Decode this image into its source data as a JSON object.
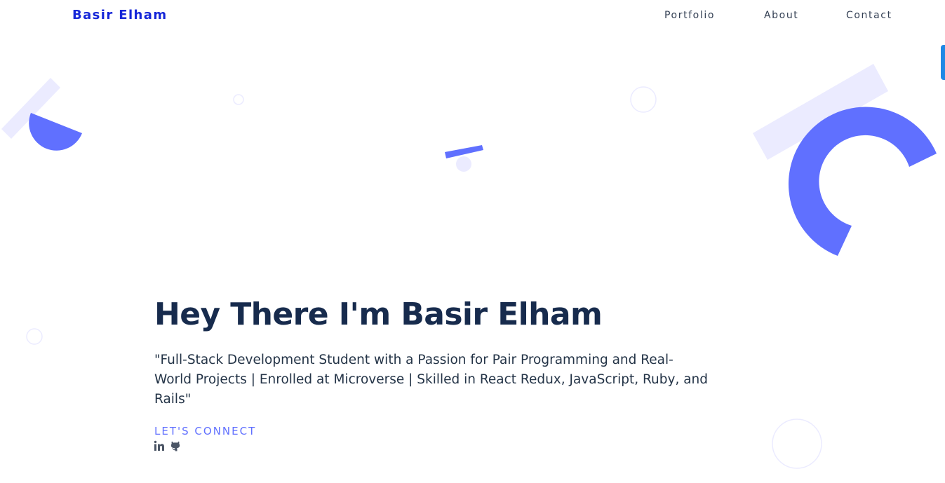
{
  "header": {
    "brand": "Basir Elham",
    "nav": [
      {
        "label": "Portfolio"
      },
      {
        "label": "About"
      },
      {
        "label": "Contact"
      }
    ]
  },
  "hero": {
    "title": "Hey There I'm Basir Elham",
    "description": "\"Full-Stack Development Student with a Passion for Pair Programming and Real-World Projects | Enrolled at Microverse | Skilled in React Redux, JavaScript, Ruby, and Rails\"",
    "connect_label": "LET'S CONNECT",
    "socials": [
      {
        "icon": "linkedin-icon"
      },
      {
        "icon": "github-icon"
      }
    ]
  },
  "colors": {
    "brand": "#1526d8",
    "accent": "#6070ff",
    "accent_light": "#ebebff",
    "heading": "#172b4d",
    "nav_text": "#344054",
    "edge_tab": "#1e88e5"
  }
}
